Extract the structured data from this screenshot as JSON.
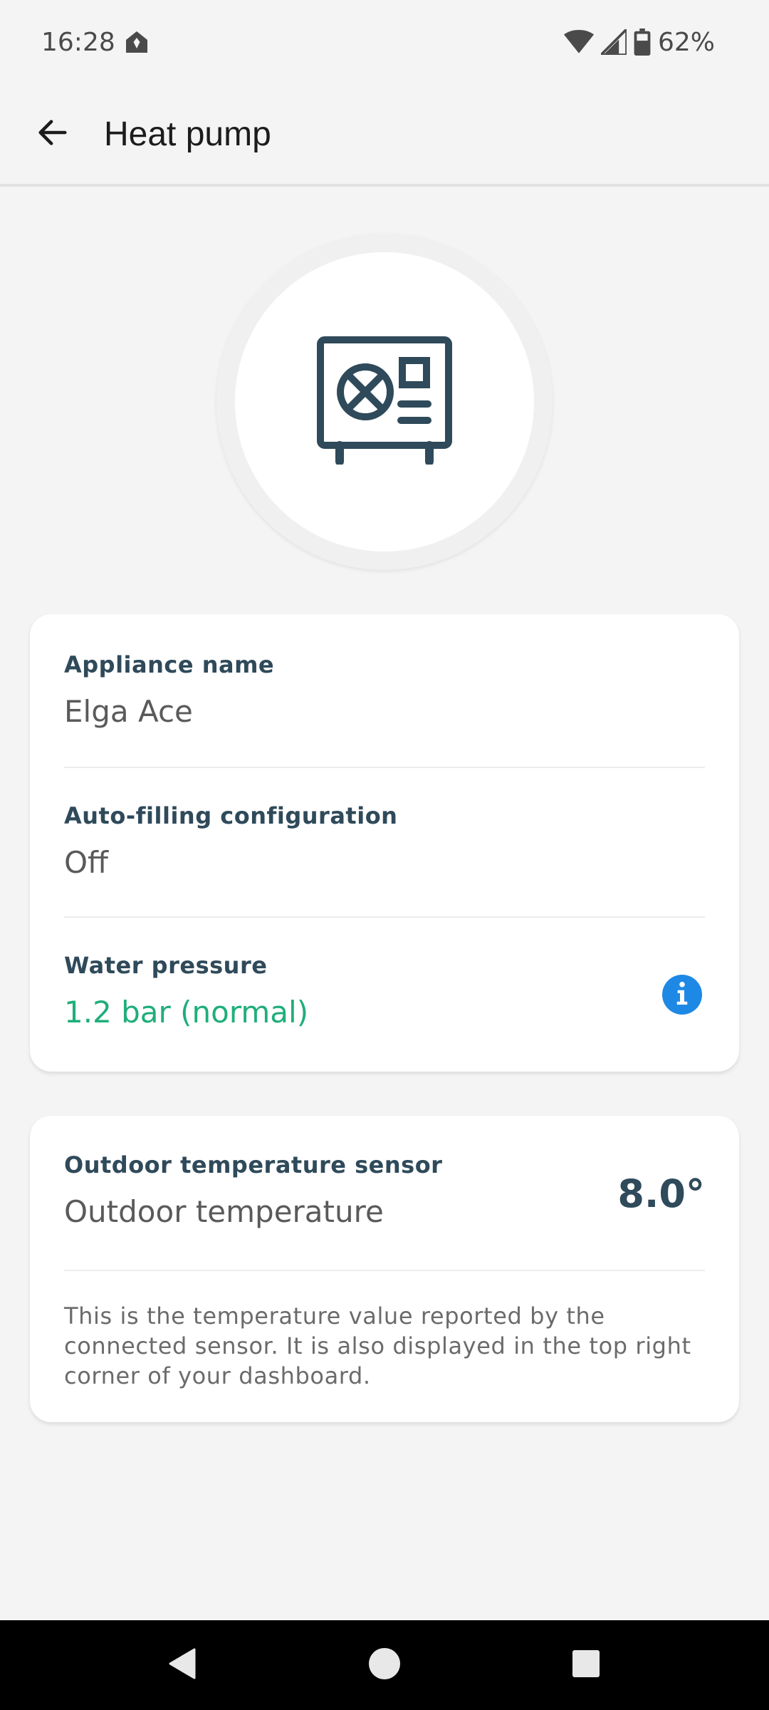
{
  "status_bar": {
    "time": "16:28",
    "battery": "62%",
    "icons": [
      "notification-icon",
      "wifi-icon",
      "signal-icon",
      "battery-icon"
    ]
  },
  "app_bar": {
    "title": "Heat pump",
    "back_icon": "arrow-back-icon"
  },
  "appliance": {
    "icon": "heat-pump-icon",
    "icon_color": "#2f4a5a"
  },
  "details": {
    "appliance_name_label": "Appliance name",
    "appliance_name_value": "Elga Ace",
    "auto_filling_label": "Auto-filling configuration",
    "auto_filling_value": "Off",
    "water_pressure_label": "Water pressure",
    "water_pressure_value": "1.2 bar (normal)",
    "water_pressure_color": "#1fae7a",
    "info_icon": "info-icon"
  },
  "sensor": {
    "label": "Outdoor temperature sensor",
    "name": "Outdoor temperature",
    "value": "8.0°",
    "description": "This is the temperature value reported by the connected sensor. It is also displayed in the top right corner of your dashboard."
  },
  "nav_bar": {
    "icons": [
      "nav-back-icon",
      "nav-home-icon",
      "nav-recents-icon"
    ]
  },
  "colors": {
    "background": "#f4f4f4",
    "accent_blue": "#1e88e5",
    "primary_text": "#2f4a5a"
  }
}
